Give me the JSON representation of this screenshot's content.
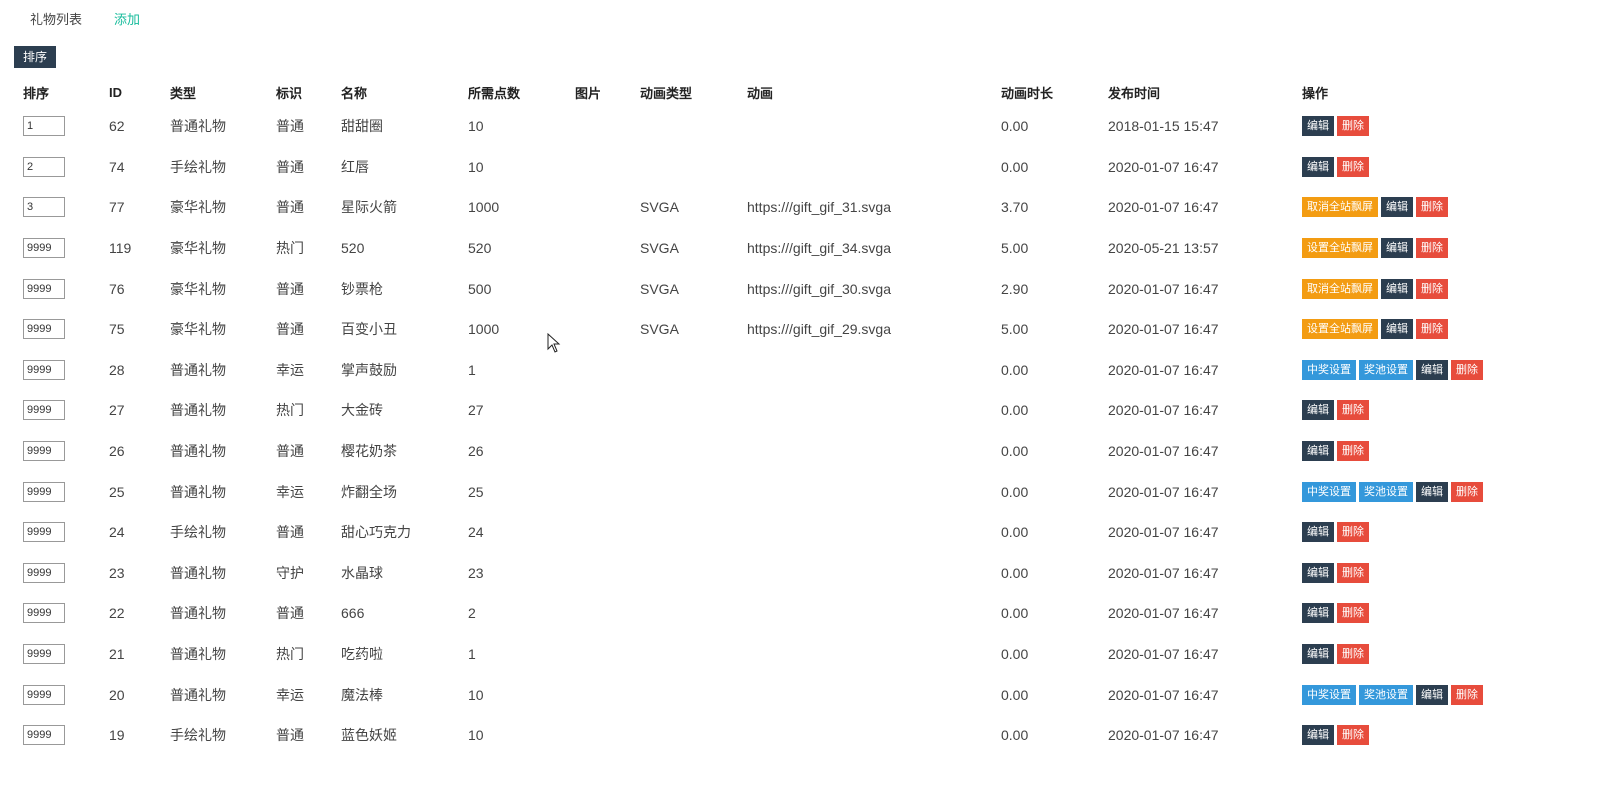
{
  "tabs": {
    "list": "礼物列表",
    "add": "添加"
  },
  "sort_button": "排序",
  "columns": [
    "排序",
    "ID",
    "类型",
    "标识",
    "名称",
    "所需点数",
    "图片",
    "动画类型",
    "动画",
    "动画时长",
    "发布时间",
    "操作"
  ],
  "labels": {
    "edit": "编辑",
    "delete": "删除",
    "cancel_screen": "取消全站飘屏",
    "set_screen": "设置全站飘屏",
    "prize_set": "中奖设置",
    "pool_set": "奖池设置"
  },
  "colors": {
    "dark": "#2c3e50",
    "red": "#e74c3c",
    "orange": "#f39c12",
    "blue": "#3498db",
    "green": "#18bc9c"
  },
  "rows": [
    {
      "order": "1",
      "id": "62",
      "type": "普通礼物",
      "mark": "普通",
      "name": "甜甜圈",
      "points": "10",
      "anim_type": "",
      "anim": "",
      "duration": "0.00",
      "time": "2018-01-15 15:47",
      "ops": [
        "edit",
        "delete"
      ]
    },
    {
      "order": "2",
      "id": "74",
      "type": "手绘礼物",
      "mark": "普通",
      "name": "红唇",
      "points": "10",
      "anim_type": "",
      "anim": "",
      "duration": "0.00",
      "time": "2020-01-07 16:47",
      "ops": [
        "edit",
        "delete"
      ]
    },
    {
      "order": "3",
      "id": "77",
      "type": "豪华礼物",
      "mark": "普通",
      "name": "星际火箭",
      "points": "1000",
      "anim_type": "SVGA",
      "anim": "https:///gift_gif_31.svga",
      "duration": "3.70",
      "time": "2020-01-07 16:47",
      "ops": [
        "cancel_screen",
        "edit",
        "delete"
      ]
    },
    {
      "order": "9999",
      "id": "119",
      "type": "豪华礼物",
      "mark": "热门",
      "name": "520",
      "points": "520",
      "anim_type": "SVGA",
      "anim": "https:///gift_gif_34.svga",
      "duration": "5.00",
      "time": "2020-05-21 13:57",
      "ops": [
        "set_screen",
        "edit",
        "delete"
      ]
    },
    {
      "order": "9999",
      "id": "76",
      "type": "豪华礼物",
      "mark": "普通",
      "name": "钞票枪",
      "points": "500",
      "anim_type": "SVGA",
      "anim": "https:///gift_gif_30.svga",
      "duration": "2.90",
      "time": "2020-01-07 16:47",
      "ops": [
        "cancel_screen",
        "edit",
        "delete"
      ]
    },
    {
      "order": "9999",
      "id": "75",
      "type": "豪华礼物",
      "mark": "普通",
      "name": "百变小丑",
      "points": "1000",
      "anim_type": "SVGA",
      "anim": "https:///gift_gif_29.svga",
      "duration": "5.00",
      "time": "2020-01-07 16:47",
      "ops": [
        "set_screen",
        "edit",
        "delete"
      ]
    },
    {
      "order": "9999",
      "id": "28",
      "type": "普通礼物",
      "mark": "幸运",
      "name": "掌声鼓励",
      "points": "1",
      "anim_type": "",
      "anim": "",
      "duration": "0.00",
      "time": "2020-01-07 16:47",
      "ops": [
        "prize_set",
        "pool_set",
        "edit",
        "delete"
      ]
    },
    {
      "order": "9999",
      "id": "27",
      "type": "普通礼物",
      "mark": "热门",
      "name": "大金砖",
      "points": "27",
      "anim_type": "",
      "anim": "",
      "duration": "0.00",
      "time": "2020-01-07 16:47",
      "ops": [
        "edit",
        "delete"
      ]
    },
    {
      "order": "9999",
      "id": "26",
      "type": "普通礼物",
      "mark": "普通",
      "name": "樱花奶茶",
      "points": "26",
      "anim_type": "",
      "anim": "",
      "duration": "0.00",
      "time": "2020-01-07 16:47",
      "ops": [
        "edit",
        "delete"
      ]
    },
    {
      "order": "9999",
      "id": "25",
      "type": "普通礼物",
      "mark": "幸运",
      "name": "炸翻全场",
      "points": "25",
      "anim_type": "",
      "anim": "",
      "duration": "0.00",
      "time": "2020-01-07 16:47",
      "ops": [
        "prize_set",
        "pool_set",
        "edit",
        "delete"
      ]
    },
    {
      "order": "9999",
      "id": "24",
      "type": "手绘礼物",
      "mark": "普通",
      "name": "甜心巧克力",
      "points": "24",
      "anim_type": "",
      "anim": "",
      "duration": "0.00",
      "time": "2020-01-07 16:47",
      "ops": [
        "edit",
        "delete"
      ]
    },
    {
      "order": "9999",
      "id": "23",
      "type": "普通礼物",
      "mark": "守护",
      "name": "水晶球",
      "points": "23",
      "anim_type": "",
      "anim": "",
      "duration": "0.00",
      "time": "2020-01-07 16:47",
      "ops": [
        "edit",
        "delete"
      ]
    },
    {
      "order": "9999",
      "id": "22",
      "type": "普通礼物",
      "mark": "普通",
      "name": "666",
      "points": "2",
      "anim_type": "",
      "anim": "",
      "duration": "0.00",
      "time": "2020-01-07 16:47",
      "ops": [
        "edit",
        "delete"
      ]
    },
    {
      "order": "9999",
      "id": "21",
      "type": "普通礼物",
      "mark": "热门",
      "name": "吃药啦",
      "points": "1",
      "anim_type": "",
      "anim": "",
      "duration": "0.00",
      "time": "2020-01-07 16:47",
      "ops": [
        "edit",
        "delete"
      ]
    },
    {
      "order": "9999",
      "id": "20",
      "type": "普通礼物",
      "mark": "幸运",
      "name": "魔法棒",
      "points": "10",
      "anim_type": "",
      "anim": "",
      "duration": "0.00",
      "time": "2020-01-07 16:47",
      "ops": [
        "prize_set",
        "pool_set",
        "edit",
        "delete"
      ]
    },
    {
      "order": "9999",
      "id": "19",
      "type": "手绘礼物",
      "mark": "普通",
      "name": "蓝色妖姬",
      "points": "10",
      "anim_type": "",
      "anim": "",
      "duration": "0.00",
      "time": "2020-01-07 16:47",
      "ops": [
        "edit",
        "delete"
      ]
    }
  ]
}
